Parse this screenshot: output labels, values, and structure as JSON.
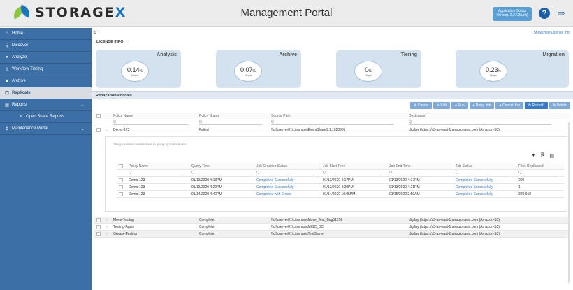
{
  "header": {
    "logo_prefix": "STORAGE",
    "logo_x": "X",
    "title": "Management Portal",
    "app_status_line1": "Application Status",
    "app_status_line2": "Version: 2.2.*.2(unk)",
    "help_icon": "?",
    "logout_icon": "⇨"
  },
  "sidebar": {
    "items": [
      {
        "label": "Home",
        "icon": "home-icon",
        "glyph": "⌂"
      },
      {
        "label": "Discover",
        "icon": "search-icon",
        "glyph": "Q"
      },
      {
        "label": "Analyze",
        "icon": "chart-icon",
        "glyph": "●"
      },
      {
        "label": "Workflow Tiering",
        "icon": "workflow-icon",
        "glyph": "♙"
      },
      {
        "label": "Archive",
        "icon": "archive-icon",
        "glyph": "▲"
      },
      {
        "label": "Replicate",
        "icon": "copy-icon",
        "glyph": "❐"
      },
      {
        "label": "Reports",
        "icon": "report-icon",
        "glyph": "▤",
        "chev": "⌄"
      },
      {
        "label": "Open Share Reports",
        "icon": "share-icon",
        "glyph": "<"
      },
      {
        "label": "Maintenance Portal",
        "icon": "tools-icon",
        "glyph": "⚙",
        "chev": "⌄"
      }
    ]
  },
  "license": {
    "gear": "⚙",
    "show_hide": "Show/Hide License Info",
    "label": "LICENSE INFO:",
    "cards": [
      {
        "title": "Analysis",
        "value": "0.14",
        "unit_small": "%",
        "sub": "Mbps"
      },
      {
        "title": "Archive",
        "value": "0.07",
        "unit_small": "%",
        "sub": "Mbps"
      },
      {
        "title": "Tiering",
        "value": "0",
        "unit_small": "%",
        "sub": "Mbps"
      },
      {
        "title": "Migration",
        "value": "0.23",
        "unit_small": "%",
        "sub": "Mbps"
      }
    ]
  },
  "panel": {
    "title": "Replication Policies",
    "toolbar": [
      "⊕ Create",
      "✎ Edit",
      "● Run",
      "● Retry Job",
      "● Cancel Job",
      "↻ Refresh",
      "⊗ Delete"
    ]
  },
  "grid": {
    "columns": [
      "Policy Name",
      "Policy Status",
      "Source Path",
      "Destination"
    ],
    "filter_glyph": "Q",
    "sort_glyph": "↑ ▼",
    "rows": [
      {
        "name": "Demo-123",
        "status": "Failed",
        "source": "\\\\cifsserver01\\cifsshare\\EventShare1.1.1020081",
        "dest": "digifay (https://s3-us-east-1.amazonaws.com (Amazon-S3)"
      }
    ],
    "lower_rows": [
      {
        "name": "Move-Testing",
        "status": "Complete",
        "source": "\\\\cifsserver01\\cifsshare\\Move_Test_Bug51256",
        "dest": "digifay (https://s3-us-east-1.amazonaws.com (Amazon-S3)"
      },
      {
        "name": "Testing-Again",
        "status": "Complete",
        "source": "\\\\cifsserver01\\cifsshare\\MISC_DC",
        "dest": "digifay (https://s3-us-east-1.amazonaws.com (Amazon-S3)"
      },
      {
        "name": "Grease-Testing",
        "status": "Complete",
        "source": "\\\\cifsserver01\\cifsshare\\TestSame",
        "dest": "digifay (https://s3-us-east-1.amazonaws.com (Amazon-S3)"
      }
    ]
  },
  "subgrid": {
    "hint": "Drag a column header here to group by that column",
    "icons": [
      "▼",
      "⎘",
      "▤"
    ],
    "columns": [
      "Policy Name",
      "Query Time",
      "Job Creation Status",
      "Job Start Time",
      "Job End Time",
      "Job Status",
      "Files Replicated"
    ],
    "rows": [
      {
        "name": "Demo-123",
        "query": "01/13/2020 4:13PM",
        "creation": "Completed Successfully",
        "start": "01/13/2020 4:17PM",
        "end": "01/13/2020 4:17PM",
        "status": "Completed Successfully",
        "files": "209"
      },
      {
        "name": "Demo-123",
        "query": "01/13/2020 4:20PM",
        "creation": "Completed Successfully",
        "start": "01/13/2020 4:20PM",
        "end": "01/13/2020 4:21PM",
        "status": "Completed Successfully",
        "files": "1"
      },
      {
        "name": "Demo-123",
        "query": "01/14/2020 4:40PM",
        "creation": "Completed with Errors",
        "start": "01/14/2020 10:05PM",
        "end": "01/15/2020 2:50AM",
        "status": "Completed Successfully",
        "files": "329,910"
      }
    ]
  }
}
